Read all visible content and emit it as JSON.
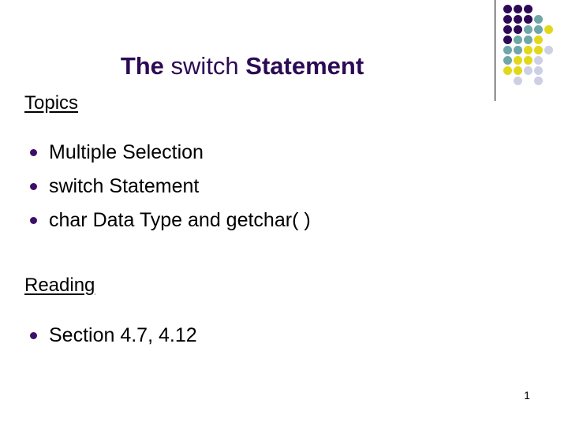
{
  "slide": {
    "page_number": "1",
    "background_color": "#ffffff",
    "title": {
      "parts": [
        {
          "text": "The ",
          "weight": "bold"
        },
        {
          "text": "switch",
          "weight": "regular"
        },
        {
          "text": " Statement",
          "weight": "bold"
        }
      ],
      "full_text": "The switch Statement",
      "color": "#2d0a54"
    },
    "sections": [
      {
        "heading": "Topics",
        "items": [
          "Multiple Selection",
          "switch Statement",
          "char Data Type and getchar( )"
        ]
      },
      {
        "heading": "Reading",
        "items": [
          "Section 4.7, 4.12"
        ]
      }
    ],
    "bullet_color": "#3d0f6b",
    "text_color": "#000000",
    "decoration": {
      "rule_color": "#000000",
      "palette": {
        "purple": "#2e0a56",
        "teal": "#6fa6a8",
        "yellow": "#e2d81a",
        "lavender": "#cdd0e4"
      },
      "dot_diameter": 11,
      "dot_pitch": 13,
      "rows": [
        [
          "purple",
          "purple",
          "purple",
          null,
          null,
          null
        ],
        [
          "purple",
          "purple",
          "purple",
          "teal",
          null,
          null
        ],
        [
          "purple",
          "purple",
          "teal",
          "teal",
          "yellow",
          null
        ],
        [
          "purple",
          "teal",
          "teal",
          "yellow",
          null,
          null
        ],
        [
          "teal",
          "teal",
          "yellow",
          "yellow",
          "lavender",
          null
        ],
        [
          "teal",
          "yellow",
          "yellow",
          "lavender",
          null,
          null
        ],
        [
          "yellow",
          "yellow",
          "lavender",
          "lavender",
          null,
          null
        ],
        [
          null,
          "lavender",
          null,
          "lavender",
          null,
          null
        ]
      ]
    }
  }
}
